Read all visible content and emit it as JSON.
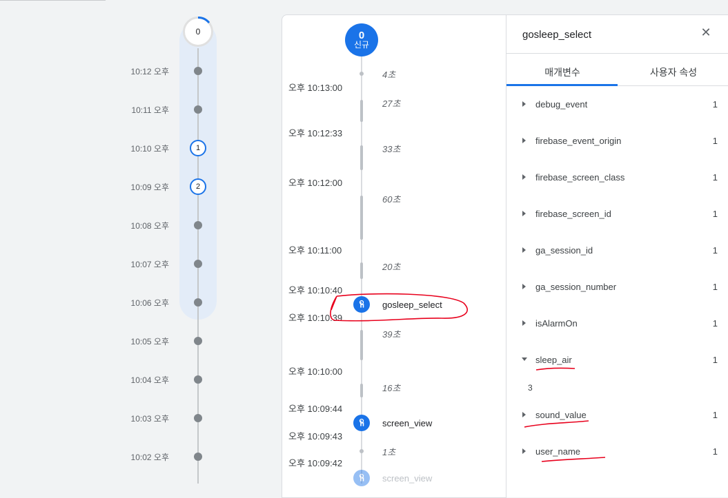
{
  "minute_timeline": {
    "top_count": "0",
    "rows": [
      {
        "label": "10:12 오후",
        "count": ""
      },
      {
        "label": "10:11 오후",
        "count": ""
      },
      {
        "label": "10:10 오후",
        "count": "1"
      },
      {
        "label": "10:09 오후",
        "count": "2"
      },
      {
        "label": "10:08 오후",
        "count": ""
      },
      {
        "label": "10:07 오후",
        "count": ""
      },
      {
        "label": "10:06 오후",
        "count": ""
      },
      {
        "label": "10:05 오후",
        "count": ""
      },
      {
        "label": "10:04 오후",
        "count": ""
      },
      {
        "label": "10:03 오후",
        "count": ""
      },
      {
        "label": "10:02 오후",
        "count": ""
      }
    ]
  },
  "event_stream": {
    "new_badge": {
      "count": "0",
      "label": "신규"
    },
    "timestamps": [
      "오후 10:13:00",
      "오후 10:12:33",
      "오후 10:12:00",
      "오후 10:11:00",
      "오후 10:10:40",
      "오후 10:10:39",
      "오후 10:10:00",
      "오후 10:09:44",
      "오후 10:09:43",
      "오후 10:09:42"
    ],
    "durations": [
      "4초",
      "27초",
      "33초",
      "60초",
      "20초",
      "39초",
      "16초",
      "1초"
    ],
    "events": [
      {
        "name": "gosleep_select",
        "icon": "touch-icon"
      },
      {
        "name": "screen_view",
        "icon": "touch-icon"
      },
      {
        "name": "screen_view",
        "icon": "touch-icon"
      }
    ]
  },
  "detail_panel": {
    "title": "gosleep_select",
    "close_icon": "close-icon",
    "tabs": [
      "매개변수",
      "사용자 속성"
    ],
    "active_tab": "매개변수",
    "params": [
      {
        "name": "debug_event",
        "count": "1"
      },
      {
        "name": "firebase_event_origin",
        "count": "1"
      },
      {
        "name": "firebase_screen_class",
        "count": "1"
      },
      {
        "name": "firebase_screen_id",
        "count": "1"
      },
      {
        "name": "ga_session_id",
        "count": "1"
      },
      {
        "name": "ga_session_number",
        "count": "1"
      },
      {
        "name": "isAlarmOn",
        "count": "1"
      },
      {
        "name": "sleep_air",
        "count": "1",
        "expanded": true,
        "value": "3"
      },
      {
        "name": "sound_value",
        "count": "1"
      },
      {
        "name": "user_name",
        "count": "1"
      }
    ]
  },
  "colors": {
    "accent": "#1a73e8",
    "annotation": "#e8001c",
    "band": "#e3ecf8"
  }
}
